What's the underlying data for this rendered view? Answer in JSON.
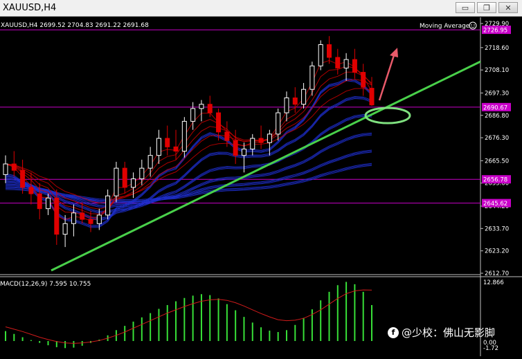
{
  "window": {
    "title": "XAUUSD,H4",
    "minimize_glyph": "▭",
    "restore_glyph": "❐",
    "close_glyph": "✕"
  },
  "header": {
    "ohlc": "XAUUSD,H4  2699.52 2704.83 2691.22 2691.68",
    "indicator_label": "Moving Average",
    "indicator_icon": "smiley-icon"
  },
  "macd": {
    "label": "MACD(12,26,9) 7.595 10.755",
    "scale_top": "12.866",
    "scale_zero": "0.00",
    "scale_bottom": "-1.72"
  },
  "watermark": {
    "logo": "f",
    "text": "@少校：佛山无影脚"
  },
  "colors": {
    "background": "#000000",
    "grid_hline": "#c900c9",
    "price_tag_bg": "#c900c9",
    "bear_candle": "#e00000",
    "bull_candle": "#ffffff",
    "trendline": "#49d04a",
    "ellipse": "#7fe07f",
    "arrow": "#e85a6a",
    "ma_red": "#cc0000",
    "ma_blue": "#1f2fd0",
    "macd_hist": "#38e038",
    "macd_signal": "#d11b1b"
  },
  "chart_data": {
    "type": "candlestick",
    "symbol": "XAUUSD",
    "timeframe": "H4",
    "ylim": [
      2612.7,
      2729.9
    ],
    "y_ticks": [
      "2729.90",
      "2718.60",
      "2708.10",
      "2697.30",
      "2686.80",
      "2676.30",
      "2665.50",
      "2655.00",
      "2644.20",
      "2633.70",
      "2623.20",
      "2612.70"
    ],
    "price_tags": [
      {
        "price": 2726.95,
        "label": "2726.95"
      },
      {
        "price": 2690.67,
        "label": "2690.67"
      },
      {
        "price": 2656.78,
        "label": "2656.78"
      },
      {
        "price": 2645.62,
        "label": "2645.62"
      }
    ],
    "candles": [
      [
        2659,
        2668,
        2655,
        2664
      ],
      [
        2664,
        2670,
        2658,
        2661
      ],
      [
        2661,
        2666,
        2650,
        2653
      ],
      [
        2653,
        2660,
        2645,
        2650
      ],
      [
        2650,
        2655,
        2638,
        2643
      ],
      [
        2643,
        2650,
        2640,
        2648
      ],
      [
        2648,
        2652,
        2626,
        2631
      ],
      [
        2631,
        2640,
        2625,
        2636
      ],
      [
        2636,
        2645,
        2630,
        2641
      ],
      [
        2641,
        2646,
        2636,
        2638
      ],
      [
        2638,
        2642,
        2632,
        2636
      ],
      [
        2636,
        2643,
        2633,
        2640
      ],
      [
        2640,
        2652,
        2638,
        2649
      ],
      [
        2649,
        2665,
        2646,
        2662
      ],
      [
        2662,
        2665,
        2650,
        2653
      ],
      [
        2653,
        2660,
        2648,
        2657
      ],
      [
        2657,
        2666,
        2654,
        2662
      ],
      [
        2662,
        2672,
        2658,
        2668
      ],
      [
        2668,
        2680,
        2664,
        2676
      ],
      [
        2676,
        2682,
        2668,
        2672
      ],
      [
        2672,
        2680,
        2666,
        2670
      ],
      [
        2670,
        2686,
        2667,
        2684
      ],
      [
        2684,
        2693,
        2680,
        2690
      ],
      [
        2690,
        2694,
        2684,
        2692
      ],
      [
        2692,
        2696,
        2686,
        2688
      ],
      [
        2688,
        2690,
        2675,
        2679
      ],
      [
        2679,
        2684,
        2672,
        2675
      ],
      [
        2675,
        2680,
        2664,
        2668
      ],
      [
        2668,
        2674,
        2660,
        2671
      ],
      [
        2671,
        2678,
        2668,
        2676
      ],
      [
        2676,
        2682,
        2671,
        2674
      ],
      [
        2674,
        2680,
        2668,
        2678
      ],
      [
        2678,
        2690,
        2675,
        2688
      ],
      [
        2688,
        2698,
        2684,
        2695
      ],
      [
        2695,
        2700,
        2688,
        2692
      ],
      [
        2692,
        2702,
        2690,
        2699
      ],
      [
        2699,
        2712,
        2696,
        2710
      ],
      [
        2710,
        2722,
        2708,
        2720
      ],
      [
        2720,
        2724,
        2711,
        2714
      ],
      [
        2714,
        2718,
        2706,
        2709
      ],
      [
        2709,
        2716,
        2703,
        2713
      ],
      [
        2713,
        2718,
        2704,
        2707
      ],
      [
        2707,
        2711,
        2696,
        2700
      ],
      [
        2699.52,
        2704.83,
        2691.22,
        2691.68
      ]
    ],
    "macd_histogram": [
      2.1,
      1.5,
      0.8,
      0.2,
      -0.4,
      -0.9,
      -1.3,
      -1.5,
      -1.4,
      -1.0,
      -0.4,
      0.3,
      1.2,
      2.3,
      3.2,
      4.1,
      5.0,
      5.9,
      6.8,
      7.6,
      8.4,
      9.1,
      9.6,
      9.9,
      9.7,
      9.0,
      7.8,
      6.5,
      5.1,
      3.9,
      2.9,
      2.2,
      1.9,
      2.3,
      3.4,
      4.9,
      6.7,
      8.6,
      10.4,
      11.8,
      12.5,
      12.0,
      10.4,
      7.6
    ],
    "macd_signal": [
      3.0,
      2.5,
      2.0,
      1.4,
      0.8,
      0.3,
      -0.1,
      -0.4,
      -0.5,
      -0.4,
      -0.2,
      0.1,
      0.6,
      1.2,
      1.9,
      2.7,
      3.5,
      4.3,
      5.1,
      5.9,
      6.6,
      7.3,
      7.9,
      8.4,
      8.7,
      8.8,
      8.6,
      8.1,
      7.4,
      6.6,
      5.8,
      5.1,
      4.5,
      4.3,
      4.4,
      4.8,
      5.6,
      6.6,
      7.8,
      9.0,
      10.0,
      10.6,
      10.8,
      10.755
    ]
  }
}
